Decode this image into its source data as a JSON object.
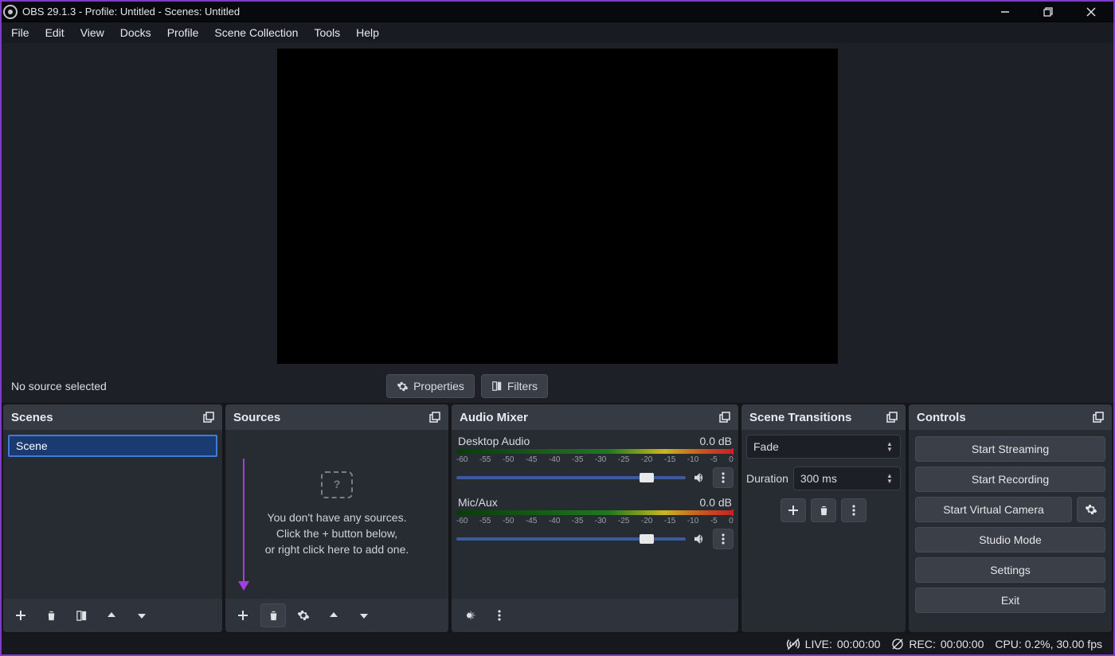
{
  "window": {
    "title": "OBS 29.1.3 - Profile: Untitled - Scenes: Untitled"
  },
  "menubar": [
    "File",
    "Edit",
    "View",
    "Docks",
    "Profile",
    "Scene Collection",
    "Tools",
    "Help"
  ],
  "toolbar": {
    "no_source": "No source selected",
    "properties": "Properties",
    "filters": "Filters"
  },
  "docks": {
    "scenes": {
      "title": "Scenes",
      "items": [
        "Scene"
      ]
    },
    "sources": {
      "title": "Sources",
      "empty_line1": "You don't have any sources.",
      "empty_line2": "Click the + button below,",
      "empty_line3": "or right click here to add one."
    },
    "mixer": {
      "title": "Audio Mixer",
      "ticks": [
        "-60",
        "-55",
        "-50",
        "-45",
        "-40",
        "-35",
        "-30",
        "-25",
        "-20",
        "-15",
        "-10",
        "-5",
        "0"
      ],
      "channels": [
        {
          "name": "Desktop Audio",
          "level": "0.0 dB"
        },
        {
          "name": "Mic/Aux",
          "level": "0.0 dB"
        }
      ]
    },
    "transitions": {
      "title": "Scene Transitions",
      "selected": "Fade",
      "duration_label": "Duration",
      "duration_value": "300 ms"
    },
    "controls": {
      "title": "Controls",
      "buttons": {
        "streaming": "Start Streaming",
        "recording": "Start Recording",
        "virtual_camera": "Start Virtual Camera",
        "studio": "Studio Mode",
        "settings": "Settings",
        "exit": "Exit"
      }
    }
  },
  "status": {
    "live_label": "LIVE:",
    "live_time": "00:00:00",
    "rec_label": "REC:",
    "rec_time": "00:00:00",
    "cpu": "CPU: 0.2%, 30.00 fps"
  }
}
